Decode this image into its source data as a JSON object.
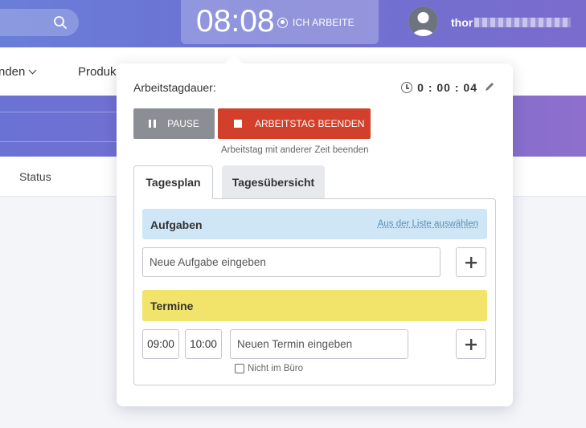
{
  "header": {
    "clock_time": "08:08",
    "clock_status": "ICH ARBEITE",
    "username": "thor"
  },
  "nav": {
    "item_partial": "nden",
    "item_products": "Produk"
  },
  "subrow": {
    "status": "Status"
  },
  "popover": {
    "duration_label": "Arbeitstagdauer:",
    "duration_value": "0 : 00 : 04",
    "pause_label": "PAUSE",
    "end_label": "ARBEITSTAG BEENDEN",
    "end_other_time": "Arbeitstag mit anderer Zeit beenden",
    "tabs": [
      {
        "label": "Tagesplan",
        "active": true
      },
      {
        "label": "Tagesübersicht",
        "active": false
      }
    ],
    "tasks": {
      "title": "Aufgaben",
      "select_link": "Aus der Liste auswählen",
      "input_placeholder": "Neue Aufgabe eingeben"
    },
    "appointments": {
      "title": "Termine",
      "from_time": "09:00",
      "to_time": "10:00",
      "input_placeholder": "Neuen Termin eingeben",
      "not_in_office": "Nicht im Büro"
    }
  },
  "colors": {
    "header_gradient_start": "#6a7ed8",
    "header_gradient_end": "#7a6ccd",
    "pause_button": "#8c8e96",
    "end_button": "#d2402b",
    "tasks_header": "#cfe6f7",
    "appointments_header": "#f2e46a"
  }
}
